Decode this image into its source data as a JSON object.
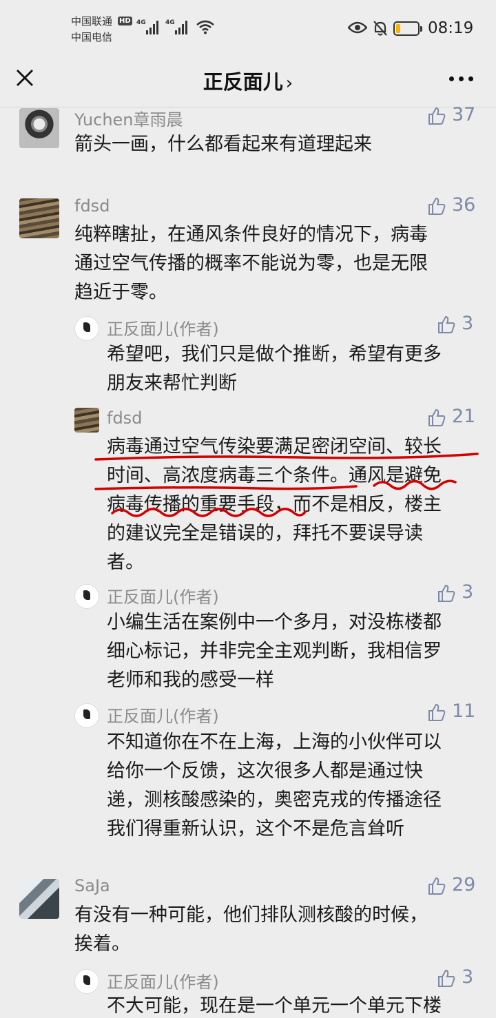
{
  "status_bar": {
    "carrier_1": "中国联通",
    "carrier_1_badge": "HD",
    "carrier_2": "中国电信",
    "signal_1": "4G",
    "signal_2": "4G",
    "battery_level": 0.2,
    "time": "08:19",
    "icons": [
      "signal-icon",
      "wifi-icon",
      "eye-icon",
      "bell-off-icon",
      "battery-icon"
    ]
  },
  "nav": {
    "title": "正反面儿",
    "chevron": "›",
    "icons": [
      "close-icon",
      "more-icon"
    ]
  },
  "colors": {
    "background": "#ededed",
    "like_count": "#7d8aa8",
    "annotation": "#d40000"
  },
  "comments": [
    {
      "name": "Yuchen章雨晨",
      "likes": "37",
      "text": "箭头一画，什么都看起来有道理起来"
    },
    {
      "name": "fdsd",
      "likes": "36",
      "text": "纯粹瞎扯，在通风条件良好的情况下，病毒\n通过空气传播的概率不能说为零，也是无限\n趋近于零。",
      "replies": [
        {
          "name": "正反面儿(作者)",
          "likes": "3",
          "text": "希望吧，我们只是做个推断，希望有更多\n朋友来帮忙判断"
        },
        {
          "name": "fdsd",
          "likes": "21",
          "text": "病毒通过空气传染要满足密闭空间、较长\n时间、高浓度病毒三个条件。通风是避免\n病毒传播的重要手段，而不是相反，楼主\n的建议完全是错误的，拜托不要误导读\n者。"
        },
        {
          "name": "正反面儿(作者)",
          "likes": "3",
          "text": "小编生活在案例中一个多月，对没栋楼都\n细心标记，并非完全主观判断，我相信罗\n老师和我的感受一样"
        },
        {
          "name": "正反面儿(作者)",
          "likes": "11",
          "text": "不知道你在不在上海，上海的小伙伴可以\n给你一个反馈，这次很多人都是通过快\n递，测核酸感染的，奥密克戎的传播途径\n我们得重新认识，这个不是危言耸听"
        }
      ]
    },
    {
      "name": "SaJa",
      "likes": "29",
      "text": "有没有一种可能，他们排队测核酸的时候，\n挨着。",
      "replies": [
        {
          "name": "正反面儿(作者)",
          "likes": "3",
          "text": "不大可能，现在是一个单元一个单元下楼"
        }
      ]
    }
  ]
}
